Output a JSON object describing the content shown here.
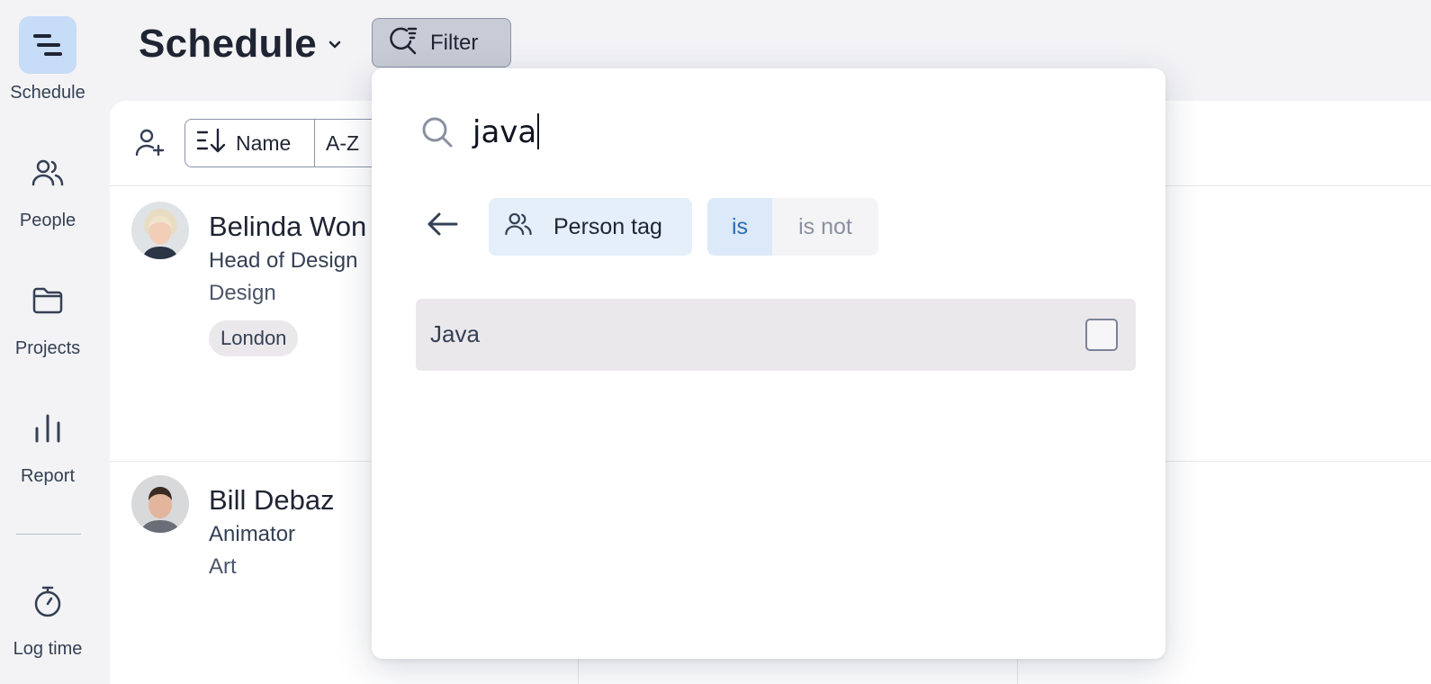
{
  "nav": {
    "items": [
      {
        "label": "Schedule",
        "icon": "schedule-icon",
        "active": true
      },
      {
        "label": "People",
        "icon": "people-icon"
      },
      {
        "label": "Projects",
        "icon": "folder-icon"
      },
      {
        "label": "Report",
        "icon": "bar-chart-icon"
      },
      {
        "label": "Log time",
        "icon": "stopwatch-icon"
      }
    ]
  },
  "header": {
    "title": "Schedule",
    "filter_label": "Filter"
  },
  "toolbar": {
    "sort_field": "Name",
    "sort_order": "A-Z"
  },
  "people": [
    {
      "name": "Belinda Won",
      "role": "Head of Design",
      "department": "Design",
      "tag": "London"
    },
    {
      "name": "Bill Debaz",
      "role": "Animator",
      "department": "Art"
    }
  ],
  "filter_popover": {
    "search_value": "java",
    "field_label": "Person tag",
    "operator_is": "is",
    "operator_is_not": "is not",
    "options": [
      {
        "label": "Java",
        "checked": false
      }
    ]
  },
  "colors": {
    "accent": "#2d6bb3",
    "active_nav_bg": "#c6dcf7",
    "chip_bg": "#e4effa"
  }
}
